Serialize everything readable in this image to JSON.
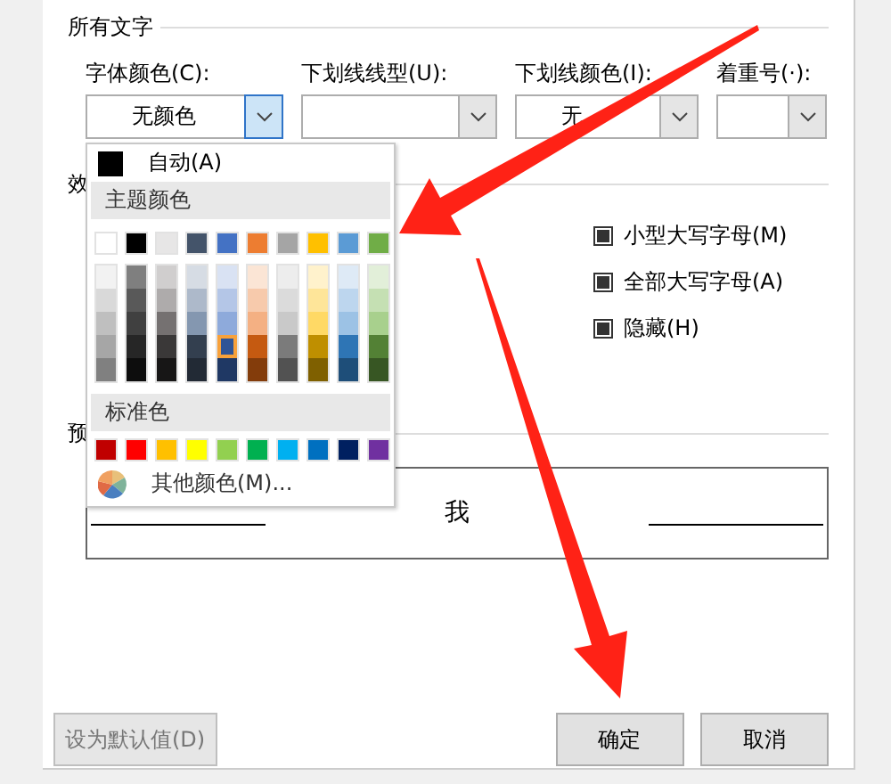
{
  "all_text_section": {
    "title": "所有文字"
  },
  "dropdowns": [
    {
      "label": "字体颜色(C):",
      "value": "无颜色",
      "open": true
    },
    {
      "label": "下划线线型(U):",
      "open": false
    },
    {
      "label": "下划线颜色(I):",
      "value": "无",
      "open": false
    },
    {
      "label": "着重号(·):",
      "open": false
    }
  ],
  "color_menu": {
    "auto": {
      "label": "自动(A)",
      "color": "#000000"
    },
    "theme_title": "主题颜色",
    "theme_colors": [
      {
        "color": "#ffffff",
        "selected": false,
        "shades": [
          {
            "color": "#f2f2f2",
            "selected": false
          },
          {
            "color": "#d9d9d9",
            "selected": false
          },
          {
            "color": "#bfbfbf",
            "selected": false
          },
          {
            "color": "#a6a6a6",
            "selected": false
          },
          {
            "color": "#808080",
            "selected": false
          }
        ]
      },
      {
        "color": "#000000",
        "selected": false,
        "shades": [
          {
            "color": "#7f7f7f",
            "selected": false
          },
          {
            "color": "#595959",
            "selected": false
          },
          {
            "color": "#404040",
            "selected": false
          },
          {
            "color": "#262626",
            "selected": false
          },
          {
            "color": "#0d0d0d",
            "selected": false
          }
        ]
      },
      {
        "color": "#e7e6e6",
        "selected": false,
        "shades": [
          {
            "color": "#d0cece",
            "selected": false
          },
          {
            "color": "#aeabab",
            "selected": false
          },
          {
            "color": "#757171",
            "selected": false
          },
          {
            "color": "#3a3838",
            "selected": false
          },
          {
            "color": "#171616",
            "selected": false
          }
        ]
      },
      {
        "color": "#44546a",
        "selected": false,
        "shades": [
          {
            "color": "#d6dce4",
            "selected": false
          },
          {
            "color": "#adb9ca",
            "selected": false
          },
          {
            "color": "#8497b0",
            "selected": false
          },
          {
            "color": "#333f4f",
            "selected": false
          },
          {
            "color": "#222a35",
            "selected": false
          }
        ]
      },
      {
        "color": "#4472c4",
        "selected": false,
        "shades": [
          {
            "color": "#d9e2f3",
            "selected": false
          },
          {
            "color": "#b4c6e7",
            "selected": false
          },
          {
            "color": "#8eaadb",
            "selected": false
          },
          {
            "color": "#2f5496",
            "selected": true
          },
          {
            "color": "#1f3864",
            "selected": false
          }
        ]
      },
      {
        "color": "#ed7d31",
        "selected": false,
        "shades": [
          {
            "color": "#fbe5d5",
            "selected": false
          },
          {
            "color": "#f7caac",
            "selected": false
          },
          {
            "color": "#f4b083",
            "selected": false
          },
          {
            "color": "#c55a11",
            "selected": false
          },
          {
            "color": "#833c0b",
            "selected": false
          }
        ]
      },
      {
        "color": "#a5a5a5",
        "selected": false,
        "shades": [
          {
            "color": "#ededed",
            "selected": false
          },
          {
            "color": "#dbdbdb",
            "selected": false
          },
          {
            "color": "#c9c9c9",
            "selected": false
          },
          {
            "color": "#7b7b7b",
            "selected": false
          },
          {
            "color": "#525252",
            "selected": false
          }
        ]
      },
      {
        "color": "#ffc000",
        "selected": false,
        "shades": [
          {
            "color": "#fff2cc",
            "selected": false
          },
          {
            "color": "#fee599",
            "selected": false
          },
          {
            "color": "#ffd965",
            "selected": false
          },
          {
            "color": "#bf8f00",
            "selected": false
          },
          {
            "color": "#7f6000",
            "selected": false
          }
        ]
      },
      {
        "color": "#5b9bd5",
        "selected": false,
        "shades": [
          {
            "color": "#deeaf6",
            "selected": false
          },
          {
            "color": "#bdd6ee",
            "selected": false
          },
          {
            "color": "#9cc2e5",
            "selected": false
          },
          {
            "color": "#2e75b5",
            "selected": false
          },
          {
            "color": "#1e4e79",
            "selected": false
          }
        ]
      },
      {
        "color": "#70ad47",
        "selected": false,
        "shades": [
          {
            "color": "#e2efd9",
            "selected": false
          },
          {
            "color": "#c5e0b3",
            "selected": false
          },
          {
            "color": "#a8d08d",
            "selected": false
          },
          {
            "color": "#538135",
            "selected": false
          },
          {
            "color": "#375623",
            "selected": false
          }
        ]
      }
    ],
    "standard_title": "标准色",
    "standard_colors": [
      {
        "color": "#c00000",
        "selected": false
      },
      {
        "color": "#ff0000",
        "selected": false
      },
      {
        "color": "#ffc000",
        "selected": false
      },
      {
        "color": "#ffff00",
        "selected": false
      },
      {
        "color": "#92d050",
        "selected": false
      },
      {
        "color": "#00b050",
        "selected": false
      },
      {
        "color": "#00b0f0",
        "selected": false
      },
      {
        "color": "#0070c0",
        "selected": false
      },
      {
        "color": "#002060",
        "selected": false
      },
      {
        "color": "#7030a0",
        "selected": false
      }
    ],
    "more_colors": "其他颜色(M)..."
  },
  "effects_section": {
    "title": "效",
    "checkboxes": [
      {
        "label": "小型大写字母(M)",
        "indeterminate": true
      },
      {
        "label": "全部大写字母(A)",
        "indeterminate": true
      },
      {
        "label": "隐藏(H)",
        "indeterminate": true
      }
    ]
  },
  "preview_section": {
    "title": "预",
    "sample": "我"
  },
  "buttons": [
    {
      "label": "设为默认值(D)",
      "disabled": true
    },
    {
      "label": "确定",
      "disabled": false
    },
    {
      "label": "取消",
      "disabled": false
    }
  ]
}
